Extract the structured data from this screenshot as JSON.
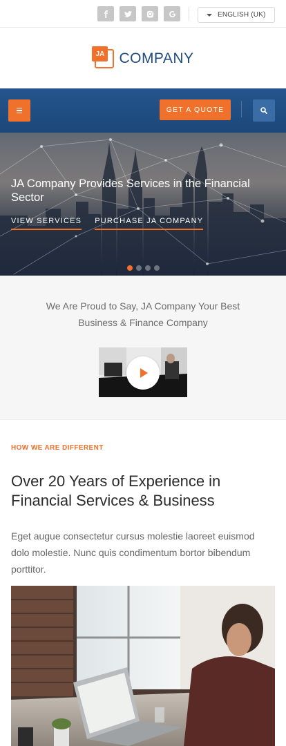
{
  "topbar": {
    "social": [
      "facebook-icon",
      "twitter-icon",
      "instagram-icon",
      "google-icon"
    ],
    "language": "ENGLISH (UK)"
  },
  "logo": {
    "mark": "JA",
    "name": "COMPANY"
  },
  "navbar": {
    "quote_label": "GET A QUOTE"
  },
  "hero": {
    "title": "JA Company Provides Services in the Financial Sector",
    "links": [
      "VIEW SERVICES",
      "PURCHASE JA COMPANY"
    ],
    "slides": {
      "count": 4,
      "active": 1
    }
  },
  "intro": {
    "text": "We Are Proud to Say, JA Company Your Best Business & Finance Company"
  },
  "different": {
    "kicker": "HOW WE ARE DIFFERENT",
    "heading": "Over 20 Years of Experience in Financial Services & Business",
    "paragraph": "Eget augue consectetur cursus molestie laoreet euismod dolo molestie. Nunc quis condimentum bortor bibendum porttitor."
  },
  "colors": {
    "accent": "#f0712c",
    "brand": "#1f4c7d",
    "nav": "#24558c"
  }
}
